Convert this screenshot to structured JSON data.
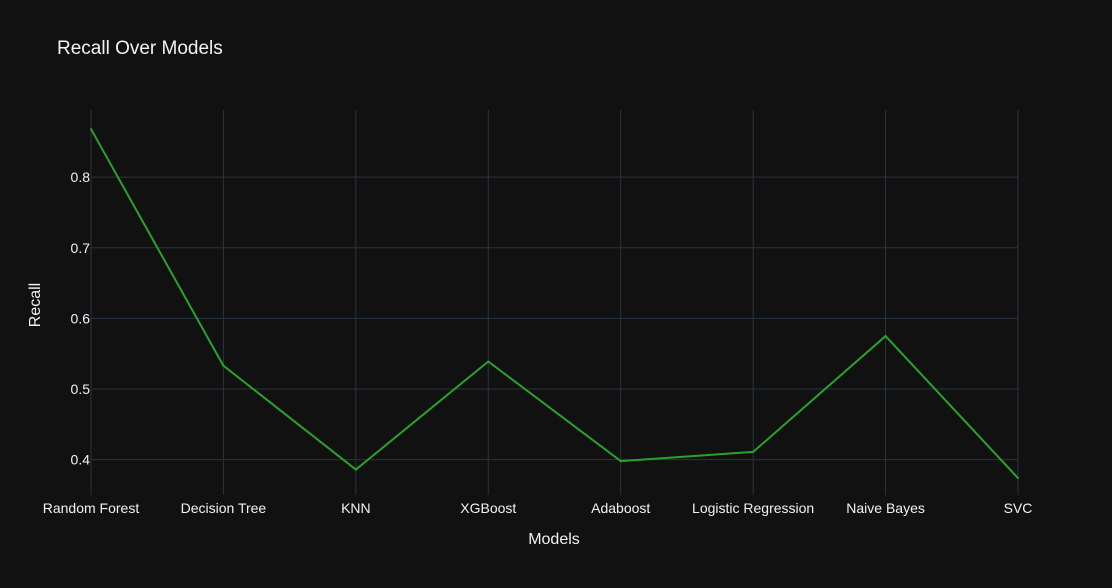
{
  "colors": {
    "paper": "#111111",
    "grid": "#283442",
    "line": "#2ca02c",
    "text": "#f2f2f2"
  },
  "chart_data": {
    "type": "line",
    "title": "Recall Over Models",
    "xlabel": "Models",
    "ylabel": "Recall",
    "categories": [
      "Random Forest",
      "Decision Tree",
      "KNN",
      "XGBoost",
      "Adaboost",
      "Logistic Regression",
      "Naive Bayes",
      "SVC"
    ],
    "series": [
      {
        "values": [
          0.868,
          0.533,
          0.386,
          0.539,
          0.398,
          0.411,
          0.575,
          0.374
        ]
      }
    ],
    "ylim": [
      0.35,
      0.895
    ],
    "yticks": [
      0.4,
      0.5,
      0.6,
      0.7,
      0.8
    ],
    "ytick_labels": [
      "0.4",
      "0.5",
      "0.6",
      "0.7",
      "0.8"
    ],
    "grid": true,
    "legend": false
  }
}
